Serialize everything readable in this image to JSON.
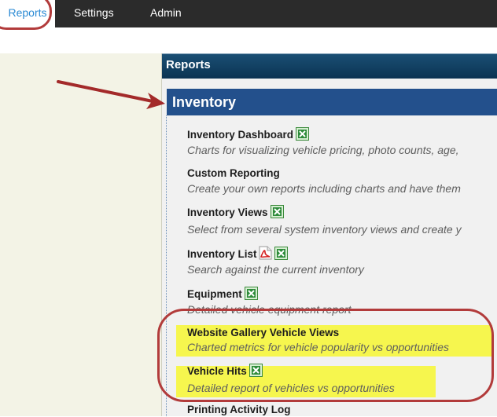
{
  "nav": {
    "tabs": [
      {
        "label": "Reports",
        "active": true
      },
      {
        "label": "Settings"
      },
      {
        "label": "Admin"
      }
    ]
  },
  "panel": {
    "title": "Reports"
  },
  "section": {
    "title": "Inventory"
  },
  "items": [
    {
      "title": "Inventory Dashboard",
      "desc": "Charts for visualizing vehicle pricing, photo counts, age,",
      "icons": [
        "excel"
      ]
    },
    {
      "title": "Custom Reporting",
      "desc": "Create your own reports including charts and have them",
      "icons": []
    },
    {
      "title": "Inventory Views",
      "desc": "Select from several system inventory views and create y",
      "icons": [
        "excel"
      ]
    },
    {
      "title": "Inventory List",
      "desc": "Search against the current inventory",
      "icons": [
        "pdf",
        "excel"
      ]
    },
    {
      "title": "Equipment",
      "desc": "Detailed vehicle equipment report",
      "icons": [
        "excel"
      ]
    },
    {
      "title": "Website Gallery Vehicle Views",
      "desc": "Charted metrics for vehicle popularity vs opportunities",
      "icons": [],
      "highlighted": true
    },
    {
      "title": "Vehicle Hits",
      "desc": "Detailed report of vehicles vs opportunities",
      "icons": [
        "excel"
      ],
      "highlighted": true
    },
    {
      "title": "Printing Activity Log",
      "desc": "",
      "icons": []
    }
  ],
  "colors": {
    "topbar": "#2b2b2b",
    "active_tab_text": "#2a8ad4",
    "section_header": "#23508c",
    "annotation": "#b23b3b",
    "highlight": "#f6f64e"
  }
}
